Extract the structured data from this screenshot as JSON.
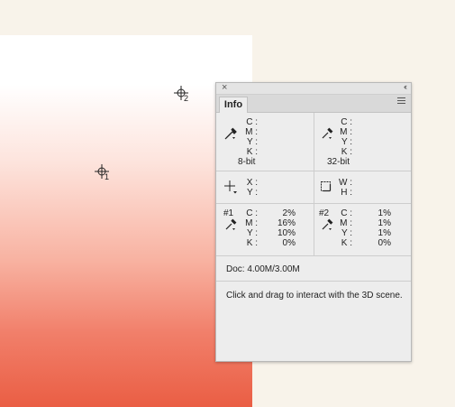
{
  "panel": {
    "close_glyph": "×",
    "collapse_glyph": "‹‹",
    "tab_label": "Info",
    "menu_icon": "panel-menu-icon"
  },
  "samplers_on_canvas": [
    {
      "label": "2",
      "icon": "color-sampler-crosshair-icon"
    },
    {
      "label": "1",
      "icon": "color-sampler-crosshair-icon"
    }
  ],
  "readout_top": {
    "left": {
      "icon": "eyedropper-icon",
      "labels": [
        "C :",
        "M :",
        "Y :",
        "K :"
      ],
      "bit_depth": "8-bit"
    },
    "right": {
      "icon": "eyedropper-icon",
      "labels": [
        "C :",
        "M :",
        "Y :",
        "K :"
      ],
      "bit_depth": "32-bit"
    }
  },
  "readout_position": {
    "left": {
      "icon": "crosshair-icon",
      "labels": [
        "X :",
        "Y :"
      ]
    },
    "right": {
      "icon": "selection-size-icon",
      "labels": [
        "W :",
        "H :"
      ]
    }
  },
  "samplers": [
    {
      "tag": "#1",
      "labels": [
        "C :",
        "M :",
        "Y :",
        "K :"
      ],
      "values": [
        "2%",
        "16%",
        "10%",
        "0%"
      ]
    },
    {
      "tag": "#2",
      "labels": [
        "C :",
        "M :",
        "Y :",
        "K :"
      ],
      "values": [
        "1%",
        "1%",
        "1%",
        "0%"
      ]
    }
  ],
  "doc_info": "Doc: 4.00M/3.00M",
  "hint": "Click and drag to interact with the 3D scene.",
  "colors": {
    "gradient_top": "#ffffff",
    "gradient_bottom": "#ea5e44",
    "workspace": "#f8f3ea"
  }
}
